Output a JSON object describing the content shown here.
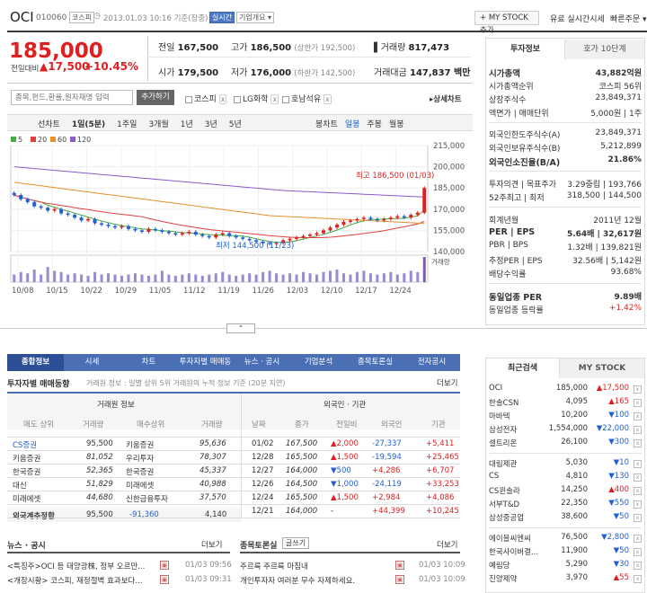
{
  "stock": {
    "name": "OCI",
    "code": "010060",
    "market": "코스피",
    "datetime": "2013.01.03 10:16 기준(장중)",
    "badge_realtime": "실시간",
    "badge_overview": "기업개요 ▾"
  },
  "header": {
    "my_stock_btn": "+ MY STOCK 추가",
    "realtime_link": "유료 실시간시세",
    "quick_order": "빠른주문 ▾"
  },
  "quote": {
    "price": "185,000",
    "change_label": "전일대비",
    "change": "▲17,500",
    "change_pct": "+10.45%",
    "prev_label": "전일",
    "prev": "167,500",
    "high_label": "고가",
    "high": "186,500",
    "upper_limit": "(상한가 192,500)",
    "volume_label": "거래량",
    "volume": "817,473",
    "open_label": "시가",
    "open": "179,500",
    "low_label": "저가",
    "low": "176,000",
    "lower_limit": "(하한가 142,500)",
    "value_label": "거래대금",
    "value": "147,837 백만"
  },
  "compare": {
    "placeholder": "종목,펀드,환율,원자재명 입력",
    "add_btn": "추가하기",
    "items": [
      "코스피",
      "LG화학",
      "호남석유"
    ],
    "detail_link": "▸상세차트"
  },
  "periods": {
    "items": [
      "선차트",
      "1일(5분)",
      "1주일",
      "3개월",
      "1년",
      "3년",
      "5년"
    ],
    "right": [
      "봉차트",
      "일봉",
      "주봉",
      "월봉"
    ]
  },
  "chart_data": {
    "type": "candlestick",
    "legend": [
      "5",
      "20",
      "60",
      "120"
    ],
    "legend_colors": [
      "#44aa44",
      "#e04040",
      "#e8902a",
      "#8a5ad0"
    ],
    "yticks": [
      "215,000",
      "200,000",
      "185,000",
      "170,000",
      "155,000",
      "140,000"
    ],
    "ylim": [
      140000,
      215000
    ],
    "xticks": [
      "10/08",
      "10/15",
      "10/22",
      "10/29",
      "11/05",
      "11/12",
      "11/19",
      "11/26",
      "12/03",
      "12/10",
      "12/17",
      "12/24"
    ],
    "max_label": "최고 186,500 (01/03)",
    "min_label": "최저 144,500 (11/23)",
    "volume_label": "거래량",
    "closes": [
      180000,
      177000,
      175000,
      172000,
      171000,
      169000,
      170000,
      167000,
      166000,
      164000,
      162000,
      163000,
      160000,
      159000,
      158000,
      157000,
      158000,
      156000,
      155000,
      154000,
      156000,
      155000,
      154000,
      153000,
      152000,
      153000,
      154000,
      152000,
      151000,
      150000,
      152000,
      153000,
      151000,
      150000,
      149000,
      148000,
      147000,
      146000,
      145500,
      146000,
      148000,
      149000,
      150000,
      151000,
      152000,
      153000,
      155000,
      157000,
      159000,
      161000,
      162000,
      163000,
      164000,
      163000,
      162000,
      163000,
      164000,
      165000,
      164000,
      166000,
      167500,
      185000
    ],
    "volumes": [
      0.3,
      0.4,
      0.35,
      0.5,
      0.3,
      0.6,
      0.45,
      0.4,
      0.3,
      0.35,
      0.3,
      0.25,
      0.4,
      0.3,
      0.35,
      0.3,
      0.25,
      0.3,
      0.35,
      0.3,
      0.25,
      0.3,
      0.45,
      0.3,
      0.25,
      0.3,
      0.35,
      0.3,
      0.25,
      0.3,
      0.35,
      0.4,
      0.3,
      0.25,
      0.3,
      0.35,
      0.3,
      0.4,
      0.45,
      0.35,
      0.3,
      0.35,
      0.3,
      0.4,
      0.35,
      0.3,
      0.4,
      0.45,
      0.5,
      0.35,
      0.3,
      0.4,
      0.45,
      0.35,
      0.3,
      0.35,
      0.4,
      0.3,
      0.35,
      0.45,
      0.4,
      1.0
    ]
  },
  "right_panel": {
    "tabs": [
      "투자정보",
      "호가 10단계"
    ],
    "rows1": [
      [
        "시가총액",
        "43,882억원"
      ],
      [
        "시가총액순위",
        "코스피 56위"
      ],
      [
        "상장주식수",
        "23,849,371"
      ],
      [
        "액면가 | 매매단위",
        "5,000원 | 1주"
      ]
    ],
    "rows2": [
      [
        "외국인한도주식수(A)",
        "23,849,371"
      ],
      [
        "외국인보유주식수(B)",
        "5,212,899"
      ],
      [
        "외국인소진율(B/A)",
        "21.86%"
      ]
    ],
    "rows3": [
      [
        "투자의견 | 목표주가",
        "3.29중립 | 193,766"
      ],
      [
        "52주최고 | 최저",
        "318,500 | 144,500"
      ]
    ],
    "rows4": [
      [
        "회계년월",
        "2011년 12월"
      ],
      [
        "PER | EPS",
        "5.64배 | 32,617원"
      ],
      [
        "PBR | BPS",
        "1.32배 | 139,821원"
      ],
      [
        "추정PER | EPS",
        "32.56배 | 5,142원"
      ],
      [
        "배당수익률",
        "93.68%"
      ]
    ],
    "rows5": [
      [
        "동일업종 PER",
        "9.89배"
      ],
      [
        "동일업종 등락률",
        "+1.42%"
      ]
    ]
  },
  "nav_tabs": [
    "종합정보",
    "시세",
    "차트",
    "투자자별 매매동향",
    "뉴스 · 공시",
    "기업분석",
    "종목토론실",
    "전자공시"
  ],
  "investor": {
    "title": "투자자별 매매동향",
    "note": "거래원 정보 : 일별 상위 5위 거래원의 누적 정보 기준 (20분 지연)",
    "more": "더보기",
    "broker_header": "거래원 정보",
    "foreign_header": "외국인 · 기관",
    "cols": [
      "매도 상위",
      "거래량",
      "매수상위",
      "거래량"
    ],
    "cols2": [
      "날짜",
      "종가",
      "전일비",
      "외국인",
      "기관"
    ],
    "brokers": [
      [
        "CS증권",
        "95,500",
        "키움증권",
        "95,636"
      ],
      [
        "키움증권",
        "81,052",
        "우리투자",
        "78,307"
      ],
      [
        "한국증권",
        "52,365",
        "한국증권",
        "45,337"
      ],
      [
        "대신",
        "51,829",
        "미래에셋",
        "40,988"
      ],
      [
        "미래에셋",
        "44,680",
        "신한금융투자",
        "37,570"
      ]
    ],
    "foreign_total": [
      "외국계추정합",
      "95,500",
      "-91,360",
      "4,140"
    ],
    "flows": [
      [
        "01/02",
        "167,500",
        "▲2,000",
        "-27,337",
        "+5,411"
      ],
      [
        "12/28",
        "165,500",
        "▲1,500",
        "-19,594",
        "+25,465"
      ],
      [
        "12/27",
        "164,000",
        "▼500",
        "+4,286",
        "+6,707"
      ],
      [
        "12/26",
        "164,500",
        "▼1,000",
        "-24,119",
        "+33,253"
      ],
      [
        "12/24",
        "165,500",
        "▲1,500",
        "+2,984",
        "+4,086"
      ],
      [
        "12/21",
        "164,000",
        "-",
        "+44,399",
        "+10,245"
      ]
    ]
  },
  "news": {
    "title": "뉴스 · 공시",
    "more": "더보기",
    "items": [
      [
        "<특징주>OCI 등 태양광株, 정부 오르만...",
        "01/03 09:56"
      ],
      [
        "<개장시황> 코스피, 재정절벽 효과보다...",
        "01/03 09:31"
      ]
    ]
  },
  "forum": {
    "title": "종목토론실",
    "write": "글쓰기",
    "more": "더보기",
    "items": [
      [
        "주르륵 주르륵 마침내",
        "01/03 10:09"
      ],
      [
        "개인투자자 여러분 무수 자제하세요.",
        "01/03 10:09"
      ]
    ]
  },
  "recent": {
    "tabs": [
      "최근검색",
      "MY STOCK"
    ],
    "items": [
      [
        "OCI",
        "185,000",
        "▲17,500"
      ],
      [
        "한솔CSN",
        "4,095",
        "▲165"
      ],
      [
        "마바텍",
        "10,200",
        "▼100"
      ],
      [
        "삼성전자",
        "1,554,000",
        "▼22,000"
      ],
      [
        "셀트리온",
        "26,100",
        "▼300"
      ],
      [
        "대림제관",
        "5,030",
        "▼10"
      ],
      [
        "CS",
        "4,810",
        "▼130"
      ],
      [
        "CS윈솔라",
        "14,250",
        "▲400"
      ],
      [
        "서부T&D",
        "22,350",
        "▼550"
      ],
      [
        "삼성중공업",
        "38,600",
        "▼50"
      ],
      [
        "에이블씨엔씨",
        "76,500",
        "▼2,800"
      ],
      [
        "한국사이버결...",
        "11,900",
        "▼50"
      ],
      [
        "예림당",
        "5,290",
        "▼30"
      ],
      [
        "진양제약",
        "3,970",
        "▲55"
      ]
    ]
  }
}
